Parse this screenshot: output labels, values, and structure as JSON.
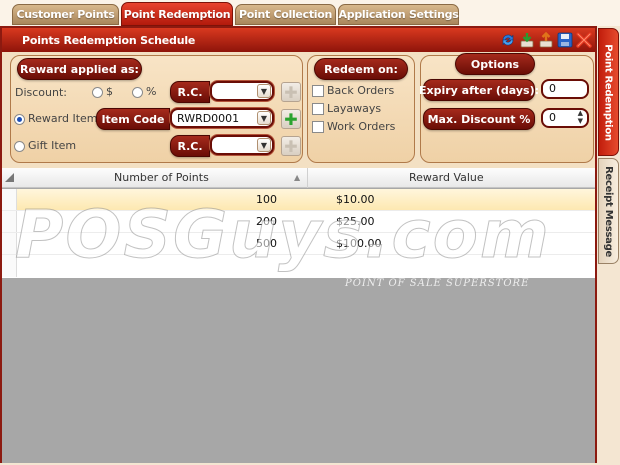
{
  "tabs": [
    {
      "label": "Customer Points",
      "active": false
    },
    {
      "label": "Point Redemption",
      "active": true
    },
    {
      "label": "Point Collection",
      "active": false
    },
    {
      "label": "Application Settings",
      "active": false
    }
  ],
  "side_tabs": [
    {
      "label": "Point Redemption",
      "active": true
    },
    {
      "label": "Receipt Message",
      "active": false
    }
  ],
  "header": {
    "title": "Points Redemption Schedule",
    "icons": [
      "refresh-icon",
      "download-icon",
      "upload-icon",
      "save-icon",
      "delete-icon"
    ]
  },
  "reward_panel": {
    "title": "Reward applied as:",
    "discount_label": "Discount:",
    "dollar_label": "$",
    "percent_label": "%",
    "rc_label_1": "R.C.",
    "rc_value_1": "",
    "reward_item_label": "Reward Item",
    "reward_item_selected": true,
    "item_code_label": "Item Code",
    "item_code_value": "RWRD0001",
    "gift_item_label": "Gift Item",
    "rc_label_2": "R.C.",
    "rc_value_2": ""
  },
  "redeem_panel": {
    "title": "Redeem on:",
    "options": [
      "Back Orders",
      "Layaways",
      "Work Orders"
    ]
  },
  "options_panel": {
    "title": "Options",
    "expiry_label": "Expiry after (days):",
    "expiry_value": "0",
    "max_discount_label": "Max. Discount %",
    "max_discount_value": "0"
  },
  "grid": {
    "columns": [
      "Number of Points",
      "Reward Value"
    ],
    "rows": [
      {
        "points": "100",
        "value": "$10.00",
        "selected": true
      },
      {
        "points": "200",
        "value": "$25.00",
        "selected": false
      },
      {
        "points": "500",
        "value": "$100.00",
        "selected": false
      }
    ]
  },
  "watermark": {
    "text": "POSGuys.com",
    "tagline": "POINT OF SALE SUPERSTORE"
  },
  "colors": {
    "accent": "#b21a0c",
    "panel_bg": "#f3e0c3",
    "pill": "#6a0d06",
    "selected_row": "#fde8b1"
  }
}
